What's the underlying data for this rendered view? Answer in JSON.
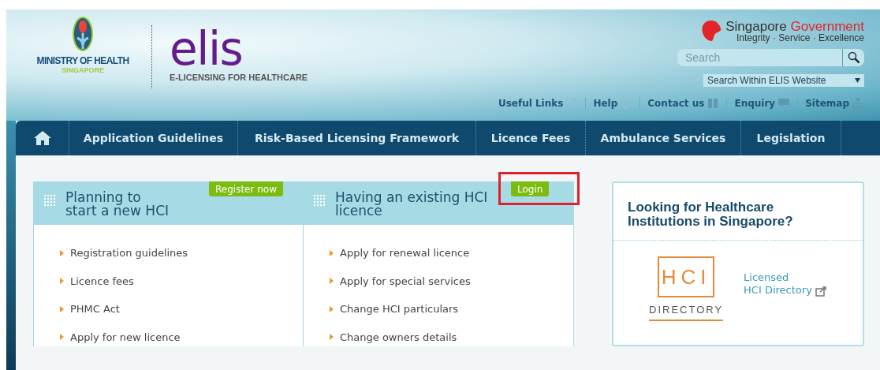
{
  "header": {
    "ministry": "MINISTRY OF HEALTH",
    "ministry_sub": "SINGAPORE",
    "logo": "elis",
    "tagline": "E-LICENSING FOR HEALTHCARE",
    "gov_name": "Singapore",
    "gov_name_2": "Government",
    "gov_motto": "Integrity · Service · Excellence",
    "search": {
      "placeholder": "Search"
    },
    "search_scope": "Search Within ELIS Website",
    "utility_links": [
      "Useful Links",
      "Help",
      "Contact us",
      "Enquiry",
      "Sitemap"
    ]
  },
  "nav": {
    "items": [
      "Application Guidelines",
      "Risk-Based Licensing Framework",
      "Licence Fees",
      "Ambulance Services",
      "Legislation"
    ]
  },
  "cards": [
    {
      "title": "Planning to\nstart a new HCI",
      "action": "Register now",
      "highlighted": false,
      "links": [
        "Registration guidelines",
        "Licence fees",
        "PHMC Act",
        "Apply for new licence"
      ]
    },
    {
      "title": "Having an existing HCI\nlicence",
      "action": "Login",
      "highlighted": true,
      "links": [
        "Apply for renewal licence",
        "Apply for special services",
        "Change HCI particulars",
        "Change owners details"
      ]
    }
  ],
  "directory": {
    "title": "Looking for Healthcare\nInstitutions in Singapore?",
    "logo_top": "HCI",
    "logo_bottom": "DIRECTORY",
    "link": "Licensed\nHCI Directory"
  }
}
